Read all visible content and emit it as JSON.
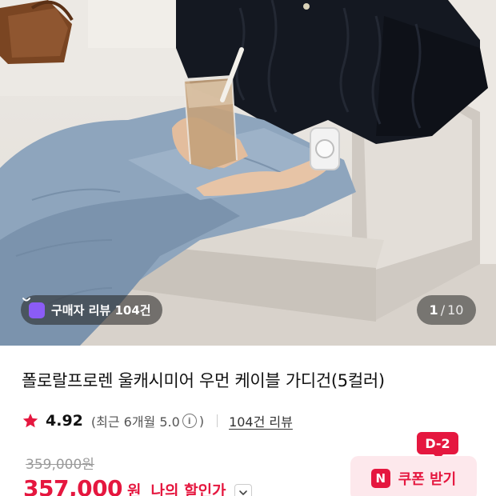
{
  "photo": {
    "review_pill_label": "구매자 리뷰 104건",
    "counter": {
      "current": "1",
      "separator": "/",
      "total": "10"
    }
  },
  "product": {
    "title": "폴로랄프로렌 울캐시미어 우먼 케이블 가디건(5컬러)",
    "rating": {
      "score": "4.92",
      "recent_prefix": "(최근 6개월 5.0",
      "recent_suffix": ")",
      "review_link": "104건 리뷰"
    },
    "original_price": "359,000원",
    "sale_price": "357,000",
    "currency": "원",
    "my_discount_label": "나의 할인가"
  },
  "coupon": {
    "dday": "D-2",
    "badge": "N",
    "label": "쿠폰 받기"
  },
  "colors": {
    "accent": "#e5173f",
    "pill_purple": "#8b5cf6",
    "coupon_bg": "#fde8ec"
  }
}
